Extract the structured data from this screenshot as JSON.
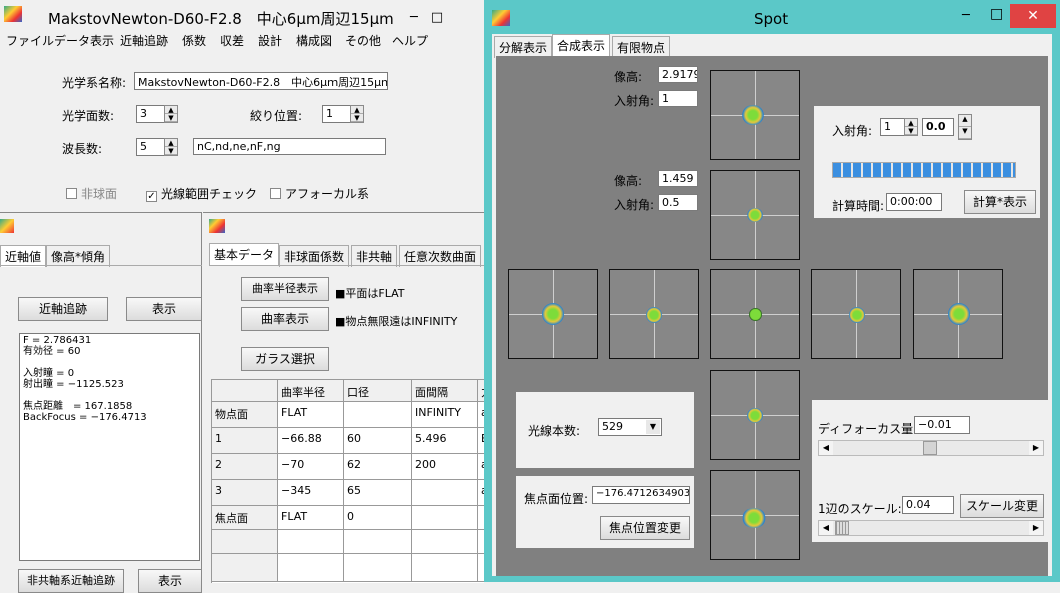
{
  "main": {
    "title": "MakstovNewton-D60-F2.8　中心6μm周辺15μm",
    "menu": [
      "ファイル",
      "データ表示",
      "近軸追跡",
      "係数",
      "収差",
      "設計",
      "構成図",
      "その他",
      "ヘルプ"
    ],
    "system_name_label": "光学系名称:",
    "system_name": "MakstovNewton-D60-F2.8　中心6μｍ周辺15μｍ",
    "surfaces_label": "光学面数:",
    "surfaces": "3",
    "stop_label": "絞り位置:",
    "stop": "1",
    "wl_label": "波長数:",
    "wl": "5",
    "wl_names": "nC,nd,ne,nF,ng",
    "aspheric": "非球面",
    "ray_check": "光線範囲チェック",
    "afocal": "アフォーカル系"
  },
  "paraxial": {
    "tabs": [
      "近軸値",
      "像高*傾角"
    ],
    "trace_btn": "近軸追跡",
    "show_btn": "表示",
    "lines": [
      "F = 2.786431",
      "有効径 = 60",
      "",
      "入射瞳 = 0",
      "射出瞳 = −1125.523",
      "",
      "焦点距離　= 167.1858",
      "BackFocus = −176.4713"
    ],
    "bottom_btn": "非共軸系近軸追跡",
    "bottom_show": "表示"
  },
  "lens": {
    "tabs": [
      "基本データ",
      "非球面係数",
      "非共軸",
      "任意次数曲面"
    ],
    "radius_btn": "曲率半径表示",
    "curv_btn": "曲率表示",
    "glass_btn": "ガラス選択",
    "note1": "■平面はFLAT",
    "note2": "■物点無限遠はINFINITY",
    "headers": [
      "",
      "曲率半径",
      "口径",
      "面間隔",
      "力"
    ],
    "rows": [
      [
        "物点面",
        "FLAT",
        "",
        "INFINITY",
        "a"
      ],
      [
        "1",
        "−66.88",
        "60",
        "5.496",
        "B"
      ],
      [
        "2",
        "−70",
        "62",
        "200",
        "a"
      ],
      [
        "3",
        "−345",
        "65",
        "",
        "a"
      ],
      [
        "焦点面",
        "FLAT",
        "0",
        "",
        ""
      ],
      [
        "",
        "",
        "",
        "",
        ""
      ],
      [
        "",
        "",
        "",
        "",
        ""
      ]
    ]
  },
  "spot": {
    "title": "Spot",
    "tabs": [
      "分解表示",
      "合成表示",
      "有限物点"
    ],
    "img_h_label": "像高:",
    "img_h1": "2.9179",
    "ang_label": "入射角:",
    "ang1": "1",
    "img_h2": "1.459",
    "ang2": "0.5",
    "inc_label": "入射角:",
    "inc_a": "1",
    "inc_b": "0.0",
    "calc_time_label": "計算時間:",
    "calc_time": "0:00:00",
    "calc_btn": "計算*表示",
    "rays_label": "光線本数:",
    "rays": "529",
    "focus_label": "焦点面位置:",
    "focus": "−176.4712634903",
    "focus_btn": "焦点位置変更",
    "defocus_label": "ディフォーカス量:",
    "defocus": "−0.01",
    "scale_label": "1辺のスケール:",
    "scale": "0.04",
    "scale_btn": "スケール変更",
    "progress": 1.0
  }
}
